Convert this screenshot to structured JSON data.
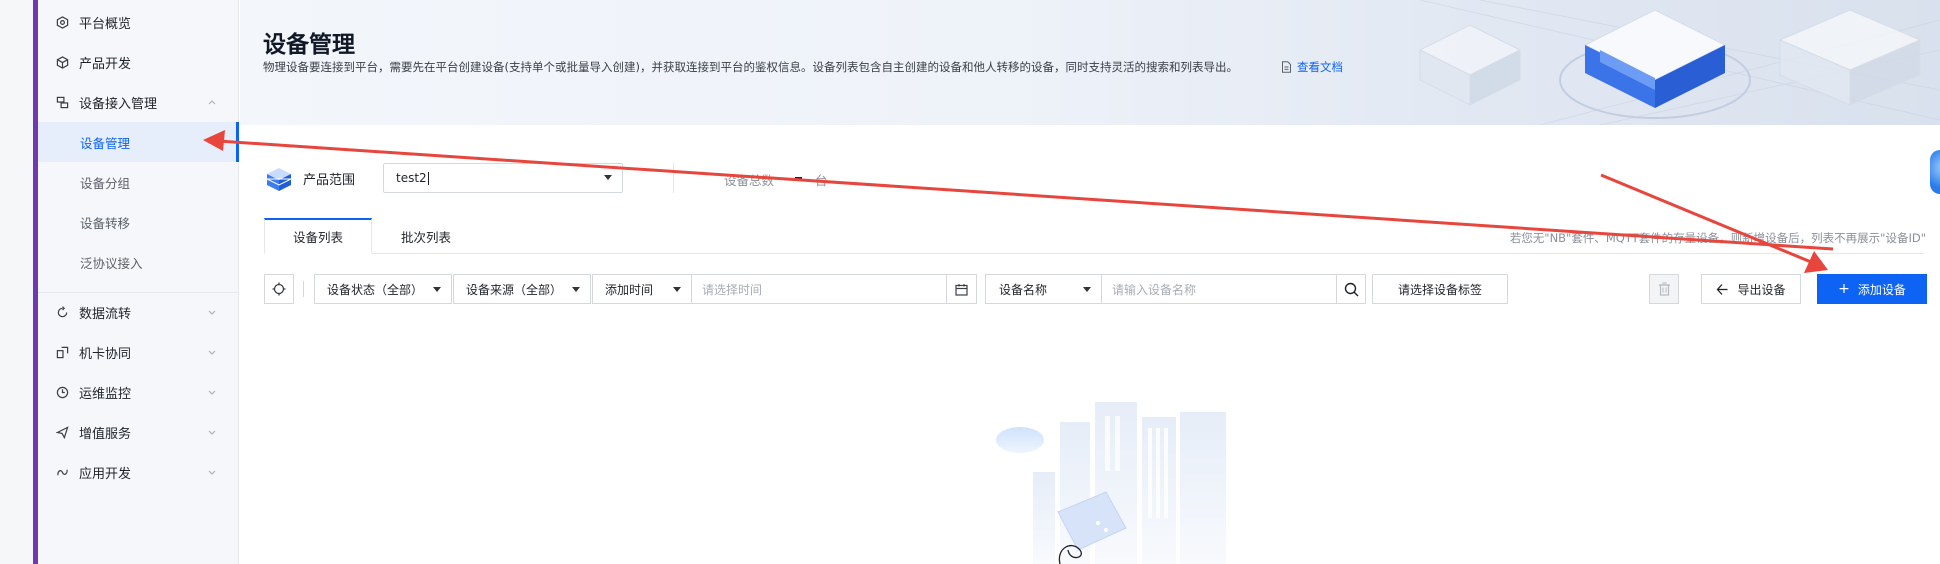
{
  "sidebar": {
    "items": [
      {
        "label": "平台概览",
        "icon": "dashboard-icon"
      },
      {
        "label": "产品开发",
        "icon": "cube-icon"
      },
      {
        "label": "设备接入管理",
        "icon": "device-access-icon",
        "expanded": true,
        "children": [
          {
            "label": "设备管理",
            "active": true
          },
          {
            "label": "设备分组"
          },
          {
            "label": "设备转移"
          },
          {
            "label": "泛协议接入"
          }
        ]
      },
      {
        "label": "数据流转",
        "icon": "data-flow-icon"
      },
      {
        "label": "机卡协同",
        "icon": "sim-card-icon"
      },
      {
        "label": "运维监控",
        "icon": "monitor-icon"
      },
      {
        "label": "增值服务",
        "icon": "send-icon"
      },
      {
        "label": "应用开发",
        "icon": "app-dev-icon"
      }
    ]
  },
  "header": {
    "title": "设备管理",
    "description": "物理设备要连接到平台，需要先在平台创建设备(支持单个或批量导入创建)，并获取连接到平台的鉴权信息。设备列表包含自主创建的设备和他人转移的设备，同时支持灵活的搜索和列表导出。",
    "doc_link": "查看文档"
  },
  "product": {
    "label": "产品范围",
    "selected": "test2",
    "total_label": "设备总数",
    "total_unit": "台"
  },
  "tabs": [
    {
      "label": "设备列表",
      "active": true
    },
    {
      "label": "批次列表",
      "active": false
    }
  ],
  "tip": "若您无\"NB\"套件、MQTT套件的存量设备，则新增设备后，列表不再展示\"设备ID\"",
  "filters": {
    "status": "设备状态（全部）",
    "source": "设备来源（全部）",
    "time_type": "添加时间",
    "time_placeholder": "请选择时间",
    "search_field": "设备名称",
    "search_placeholder": "请输入设备名称",
    "tag_placeholder": "请选择设备标签"
  },
  "actions": {
    "export": "导出设备",
    "add": "添加设备"
  },
  "colors": {
    "primary": "#0d63f3",
    "sidebar_accent": "#6e3ab3",
    "annotation_arrow": "#e8453c"
  }
}
